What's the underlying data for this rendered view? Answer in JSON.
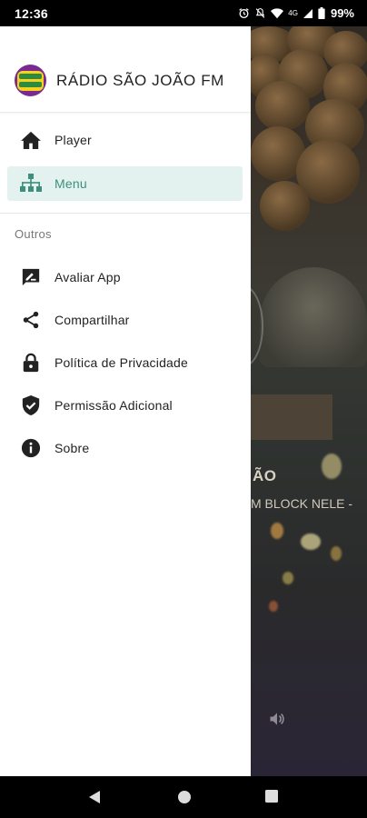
{
  "status_bar": {
    "time": "12:36",
    "battery": "99%",
    "icons": [
      "alarm-icon",
      "mute-icon",
      "wifi-icon",
      "signal-4g-icon",
      "signal-icon",
      "battery-icon"
    ]
  },
  "app": {
    "title": "RÁDIO SÃO JOÃO FM",
    "logo": "sao-joao-logo"
  },
  "drawer": {
    "primary_items": [
      {
        "label": "Player",
        "icon": "home-icon",
        "active": false
      },
      {
        "label": "Menu",
        "icon": "sitemap-icon",
        "active": true
      }
    ],
    "section_title": "Outros",
    "secondary_items": [
      {
        "label": "Avaliar App",
        "icon": "rate-review-icon"
      },
      {
        "label": "Compartilhar",
        "icon": "share-icon"
      },
      {
        "label": "Política de Privacidade",
        "icon": "lock-icon"
      },
      {
        "label": "Permissão Adicional",
        "icon": "shield-check-icon"
      },
      {
        "label": "Sobre",
        "icon": "info-icon"
      }
    ]
  },
  "background": {
    "title_fragment": "ÃO",
    "subtitle_fragment": "M BLOCK NELE -"
  },
  "colors": {
    "accent": "#3e8f7e",
    "active_bg": "#e3f2ee"
  }
}
